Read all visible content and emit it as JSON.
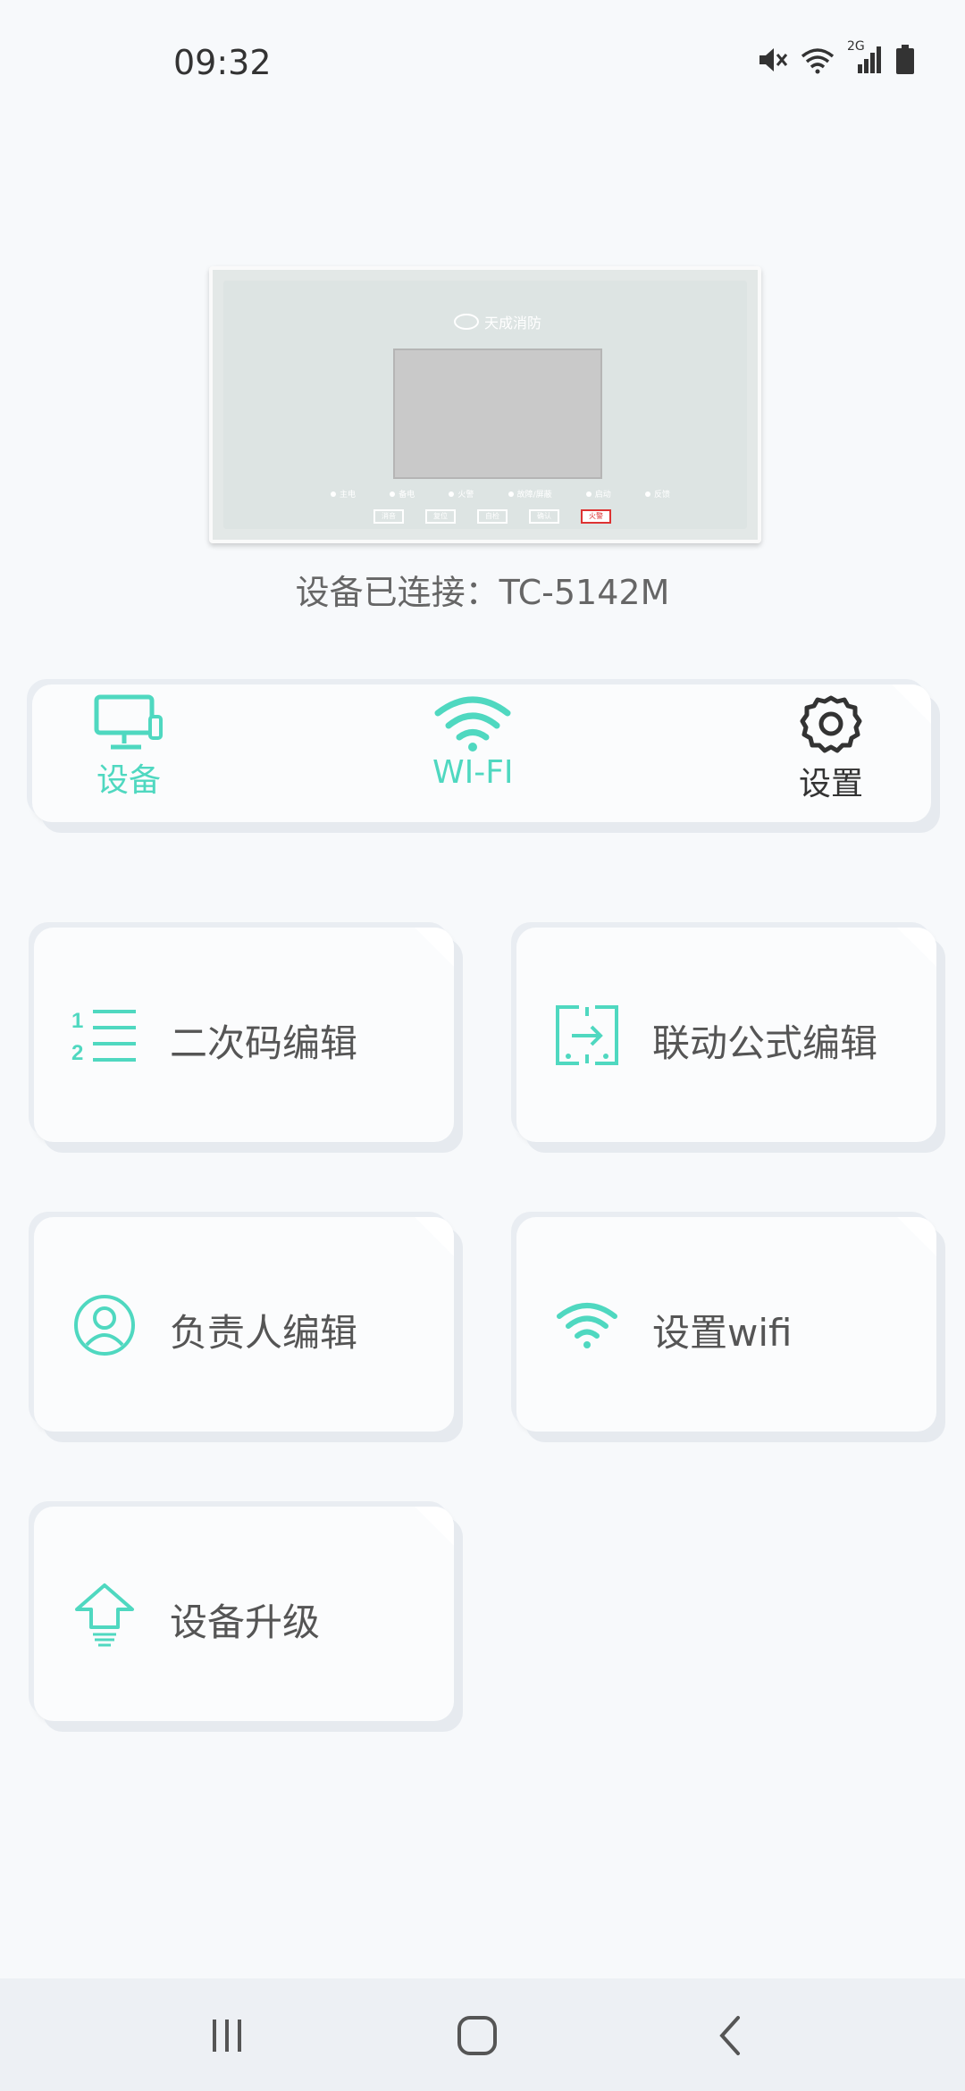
{
  "status_bar": {
    "time": "09:32",
    "network_label": "2G",
    "icons": [
      "mute-icon",
      "wifi-icon",
      "signal-icon",
      "battery-icon"
    ]
  },
  "device": {
    "caption": "设备已连接：TC-5142M",
    "logo_text": "天成消防",
    "led_labels": [
      "主电",
      "备电",
      "火警",
      "故障/屏蔽",
      "启动",
      "反馈"
    ],
    "key_labels": [
      "消音",
      "复位",
      "自检",
      "确认",
      "火警"
    ]
  },
  "tabs": [
    {
      "label": "设备",
      "icon": "monitor-icon",
      "color": "#4fd8c0"
    },
    {
      "label": "WI-FI",
      "icon": "wifi-icon",
      "color": "#4fd8c0"
    },
    {
      "label": "设置",
      "icon": "gear-icon",
      "color": "#333333"
    }
  ],
  "functions": [
    {
      "label": "二次码编辑",
      "icon": "numbered-list-icon"
    },
    {
      "label": "联动公式编辑",
      "icon": "linkage-icon"
    },
    {
      "label": "负责人编辑",
      "icon": "user-icon"
    },
    {
      "label": "设置wifi",
      "icon": "wifi-icon"
    },
    {
      "label": "设备升级",
      "icon": "upgrade-icon"
    }
  ],
  "colors": {
    "accent": "#4fd8c0",
    "text": "#555555",
    "background": "#f7f9fb"
  },
  "navbar": {
    "buttons": [
      "recent-apps",
      "home",
      "back"
    ]
  }
}
